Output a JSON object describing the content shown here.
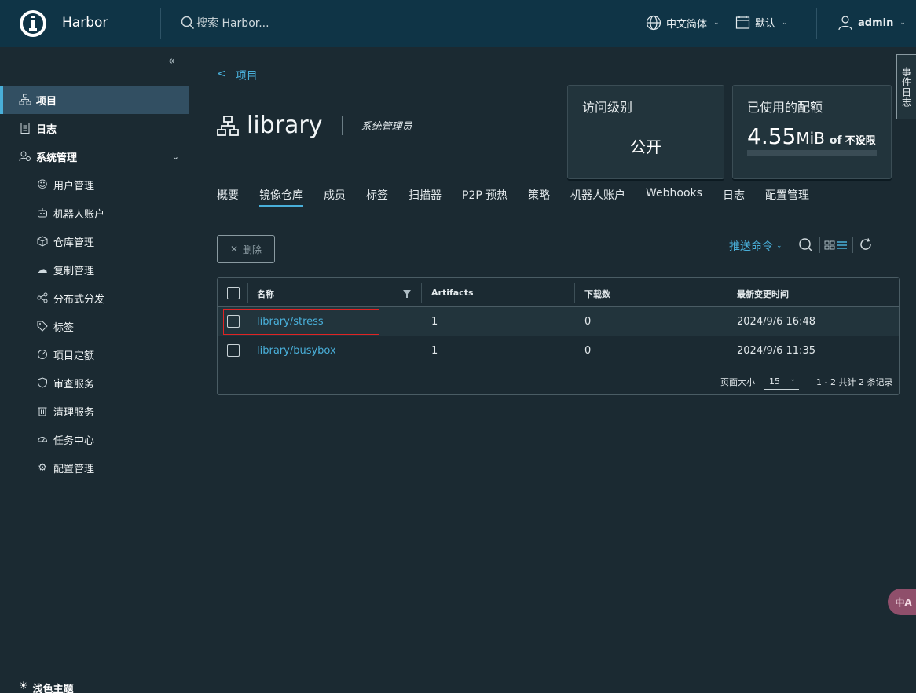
{
  "header": {
    "brand": "Harbor",
    "search_placeholder": "搜索 Harbor...",
    "language": "中文简体",
    "datetime_format": "默认",
    "user": "admin"
  },
  "sidebar": {
    "items": [
      {
        "label": "项目",
        "icon": "project-icon",
        "active": true
      },
      {
        "label": "日志",
        "icon": "log-icon"
      },
      {
        "label": "系统管理",
        "icon": "admin-icon",
        "expandable": true
      }
    ],
    "subitems": [
      {
        "label": "用户管理",
        "icon": "users-icon"
      },
      {
        "label": "机器人账户",
        "icon": "robot-icon"
      },
      {
        "label": "仓库管理",
        "icon": "registry-icon"
      },
      {
        "label": "复制管理",
        "icon": "replication-icon"
      },
      {
        "label": "分布式分发",
        "icon": "share-icon"
      },
      {
        "label": "标签",
        "icon": "tag-icon"
      },
      {
        "label": "项目定额",
        "icon": "quota-icon"
      },
      {
        "label": "审查服务",
        "icon": "shield-icon"
      },
      {
        "label": "清理服务",
        "icon": "trash-icon"
      },
      {
        "label": "任务中心",
        "icon": "dashboard-icon"
      },
      {
        "label": "配置管理",
        "icon": "gear-icon"
      }
    ],
    "theme_label": "浅色主题"
  },
  "project": {
    "back_label": "项目",
    "name": "library",
    "role": "系统管理员",
    "access_title": "访问级别",
    "access_value": "公开",
    "quota_title": "已使用的配额",
    "quota_used": "4.55",
    "quota_unit": "MiB",
    "quota_of": "of",
    "quota_limit": "不设限",
    "quota_fraction": 0
  },
  "tabs": [
    "概要",
    "镜像仓库",
    "成员",
    "标签",
    "扫描器",
    "P2P 预热",
    "策略",
    "机器人账户",
    "Webhooks",
    "日志",
    "配置管理"
  ],
  "active_tab": "镜像仓库",
  "toolbar": {
    "delete_label": "删除",
    "push_command_label": "推送命令"
  },
  "table": {
    "columns": [
      "名称",
      "Artifacts",
      "下载数",
      "最新变更时间"
    ],
    "rows": [
      {
        "name": "library/stress",
        "artifacts": "1",
        "pulls": "0",
        "updated": "2024/9/6 16:48"
      },
      {
        "name": "library/busybox",
        "artifacts": "1",
        "pulls": "0",
        "updated": "2024/9/6 11:35"
      }
    ],
    "page_size_label": "页面大小",
    "page_size": "15",
    "total_label": "1 - 2 共计 2 条记录"
  },
  "event_log_label": "事件日志",
  "translate_label": "中A",
  "colors": {
    "accent": "#49afd9",
    "header_bg": "#0f3446",
    "body_bg": "#1b2a32",
    "highlight_box": "#e02424"
  }
}
